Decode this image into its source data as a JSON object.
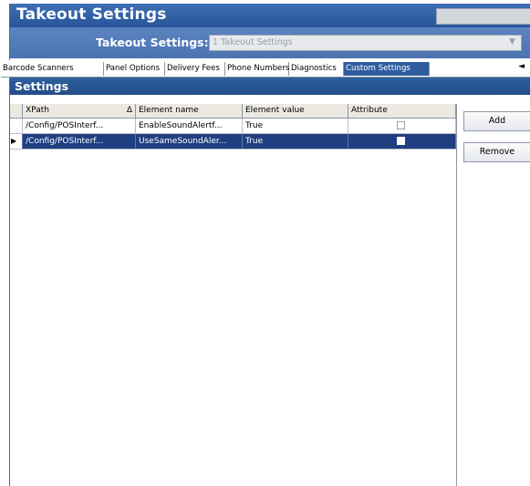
{
  "window": {
    "title": "Takeout Settings"
  },
  "selector": {
    "label": "Takeout Settings:",
    "value": "1 Takeout Settings",
    "chevron_icon": "chevron-down-icon"
  },
  "tabs": [
    {
      "label": "Barcode Scanners",
      "active": false
    },
    {
      "label": "Panel Options",
      "active": false
    },
    {
      "label": "Delivery Fees",
      "active": false
    },
    {
      "label": "Phone Numbers",
      "active": false
    },
    {
      "label": "Diagnostics",
      "active": false
    },
    {
      "label": "Custom Settings",
      "active": true
    }
  ],
  "tab_scroll_icon": "chevron-left-icon",
  "section": {
    "title": "Settings"
  },
  "grid": {
    "columns": [
      "XPath",
      "Element name",
      "Element value",
      "Attribute"
    ],
    "sort_indicator": "Δ",
    "rows": [
      {
        "xpath": "/Config/POSInterf...",
        "element_name": "EnableSoundAlertf...",
        "element_value": "True",
        "attribute": false,
        "selected": false
      },
      {
        "xpath": "/Config/POSInterf...",
        "element_name": "UseSameSoundAler...",
        "element_value": "True",
        "attribute": false,
        "selected": true
      }
    ]
  },
  "buttons": {
    "add": "Add",
    "remove": "Remove"
  },
  "colors": {
    "title_bar": "#2e5c9f",
    "selection": "#1f3f80",
    "active_tab": "#2e5c9f"
  }
}
